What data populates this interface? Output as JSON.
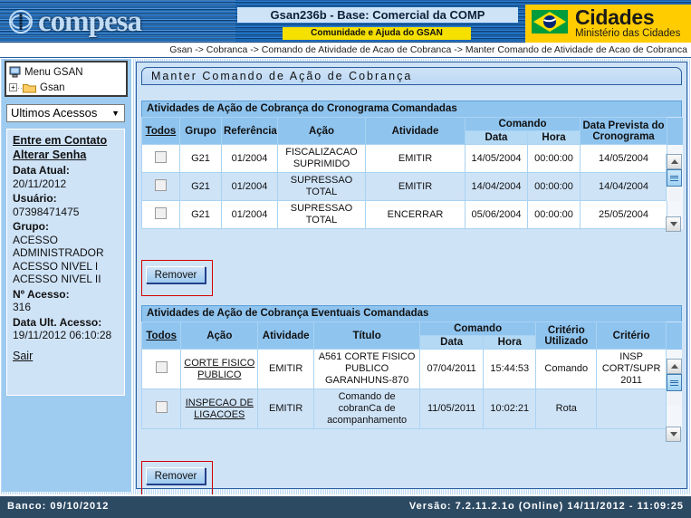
{
  "header": {
    "brand": "compesa",
    "title": "Gsan236b - Base: Comercial da COMP",
    "subtitle": "Comunidade e Ajuda do GSAN",
    "ministry_big": "Cidades",
    "ministry_small": "Ministério das Cidades"
  },
  "breadcrumb": "Gsan -> Cobranca -> Comando de Atividade de Acao de Cobranca -> Manter Comando de Atividade de Acao de Cobranca",
  "sidebar": {
    "tree": {
      "root_label": "Menu GSAN",
      "child_label": "Gsan",
      "expander": "+"
    },
    "dropdown": {
      "selected": "Ultimos Acessos",
      "caret": "▼"
    },
    "links": {
      "contato": "Entre em Contato",
      "senha": "Alterar Senha",
      "sair": "Sair"
    },
    "fields": [
      {
        "label": "Data Atual:",
        "value": "20/11/2012"
      },
      {
        "label": "Usuário:",
        "value": "07398471475"
      },
      {
        "label": "Grupo:",
        "value": "ACESSO ADMINISTRADOR ACESSO NIVEL I ACESSO NIVEL II"
      },
      {
        "label": "Nº Acesso:",
        "value": "316"
      },
      {
        "label": "Data Ult. Acesso:",
        "value": "19/11/2012 06:10:28"
      }
    ],
    "grupo_lines": [
      "ACESSO",
      "ADMINISTRADOR",
      "ACESSO NIVEL I",
      "ACESSO NIVEL II"
    ]
  },
  "main": {
    "panel_title": "Manter Comando de Ação de Cobrança",
    "section1": {
      "header": "Atividades de Ação de Cobrança do Cronograma Comandadas",
      "columns": {
        "todos": "Todos",
        "grupo": "Grupo",
        "referencia": "Referência",
        "acao": "Ação",
        "atividade": "Atividade",
        "comando": "Comando",
        "data": "Data",
        "hora": "Hora",
        "data_prevista": "Data Prevista do Cronograma"
      },
      "rows": [
        {
          "grupo": "G21",
          "referencia": "01/2004",
          "acao": "FISCALIZACAO SUPRIMIDO",
          "atividade": "EMITIR",
          "data": "14/05/2004",
          "hora": "00:00:00",
          "data_prevista": "14/05/2004"
        },
        {
          "grupo": "G21",
          "referencia": "01/2004",
          "acao": "SUPRESSAO TOTAL",
          "atividade": "EMITIR",
          "data": "14/04/2004",
          "hora": "00:00:00",
          "data_prevista": "14/04/2004"
        },
        {
          "grupo": "G21",
          "referencia": "01/2004",
          "acao": "SUPRESSAO TOTAL",
          "atividade": "ENCERRAR",
          "data": "05/06/2004",
          "hora": "00:00:00",
          "data_prevista": "25/05/2004"
        }
      ],
      "remover_label": "Remover"
    },
    "section2": {
      "header": "Atividades de Ação de Cobrança Eventuais Comandadas",
      "columns": {
        "todos": "Todos",
        "acao": "Ação",
        "atividade": "Atividade",
        "titulo": "Título",
        "comando": "Comando",
        "data": "Data",
        "hora": "Hora",
        "criterio_utilizado": "Critério Utilizado",
        "criterio": "Critério"
      },
      "rows": [
        {
          "acao": "CORTE FISICO PUBLICO",
          "atividade": "EMITIR",
          "titulo": "A561 CORTE FISICO PUBLICO GARANHUNS-870",
          "data": "07/04/2011",
          "hora": "15:44:53",
          "criterio_utilizado": "Comando",
          "criterio": "INSP CORT/SUPR 2011"
        },
        {
          "acao": "INSPECAO DE LIGACOES",
          "atividade": "EMITIR",
          "titulo": "Comando de cobranCa de acompanhamento",
          "data": "11/05/2011",
          "hora": "10:02:21",
          "criterio_utilizado": "Rota",
          "criterio": ""
        }
      ],
      "remover_label": "Remover"
    }
  },
  "footer": {
    "banco": "Banco: 09/10/2012",
    "versao": "Versão: 7.2.11.2.1o (Online) 14/11/2012 - 11:09:25"
  },
  "colors": {
    "header_navy": "#0a2540",
    "panel_blue": "#cfe3f7",
    "grid_header": "#8fc4ef",
    "accent_yellow": "#ffcc00",
    "highlight_red": "#d40000",
    "footer_slate": "#2d4a63"
  }
}
